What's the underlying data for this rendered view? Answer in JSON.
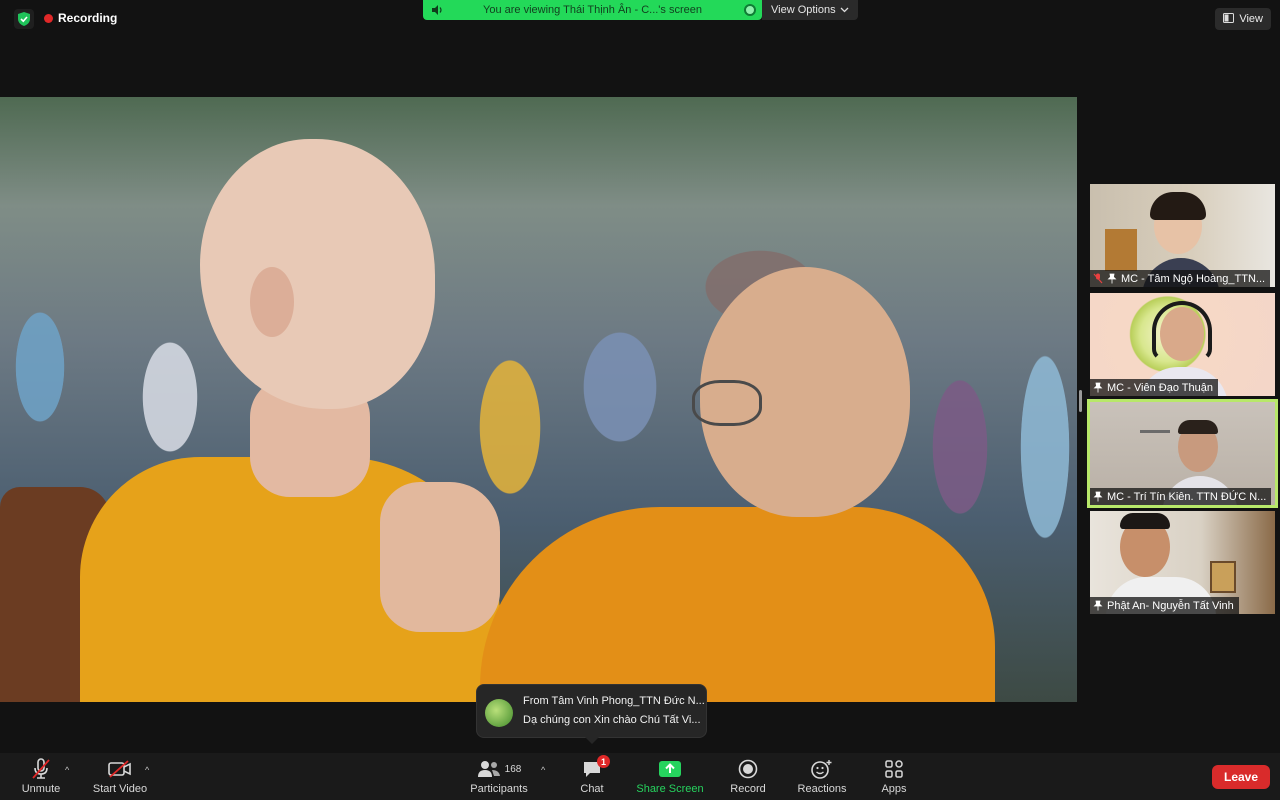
{
  "top": {
    "recording_label": "Recording",
    "viewing_text": "You are viewing Thái Thịnh Ân - C...'s screen",
    "view_options_label": "View Options",
    "view_label": "View"
  },
  "participants": [
    {
      "name": "MC - Tâm Ngộ Hoàng_TTN..."
    },
    {
      "name": "MC - Viên Đạo Thuận"
    },
    {
      "name": "MC - Trí Tín Kiên. TTN ĐỨC N..."
    },
    {
      "name": "Phật An- Nguyễn Tất Vinh"
    }
  ],
  "chat_toast": {
    "from": "From Tâm Vinh Phong_TTN Đức N...",
    "message": "Dạ chúng con Xin chào Chú Tất Vi..."
  },
  "toolbar": {
    "unmute": "Unmute",
    "start_video": "Start Video",
    "participants": "Participants",
    "participants_count": "168",
    "chat": "Chat",
    "chat_badge": "1",
    "share_screen": "Share Screen",
    "record": "Record",
    "reactions": "Reactions",
    "apps": "Apps",
    "leave": "Leave"
  },
  "colors": {
    "share_green": "#23d959",
    "leave_red": "#d92b2b",
    "active_speaker": "#b8e86a"
  }
}
